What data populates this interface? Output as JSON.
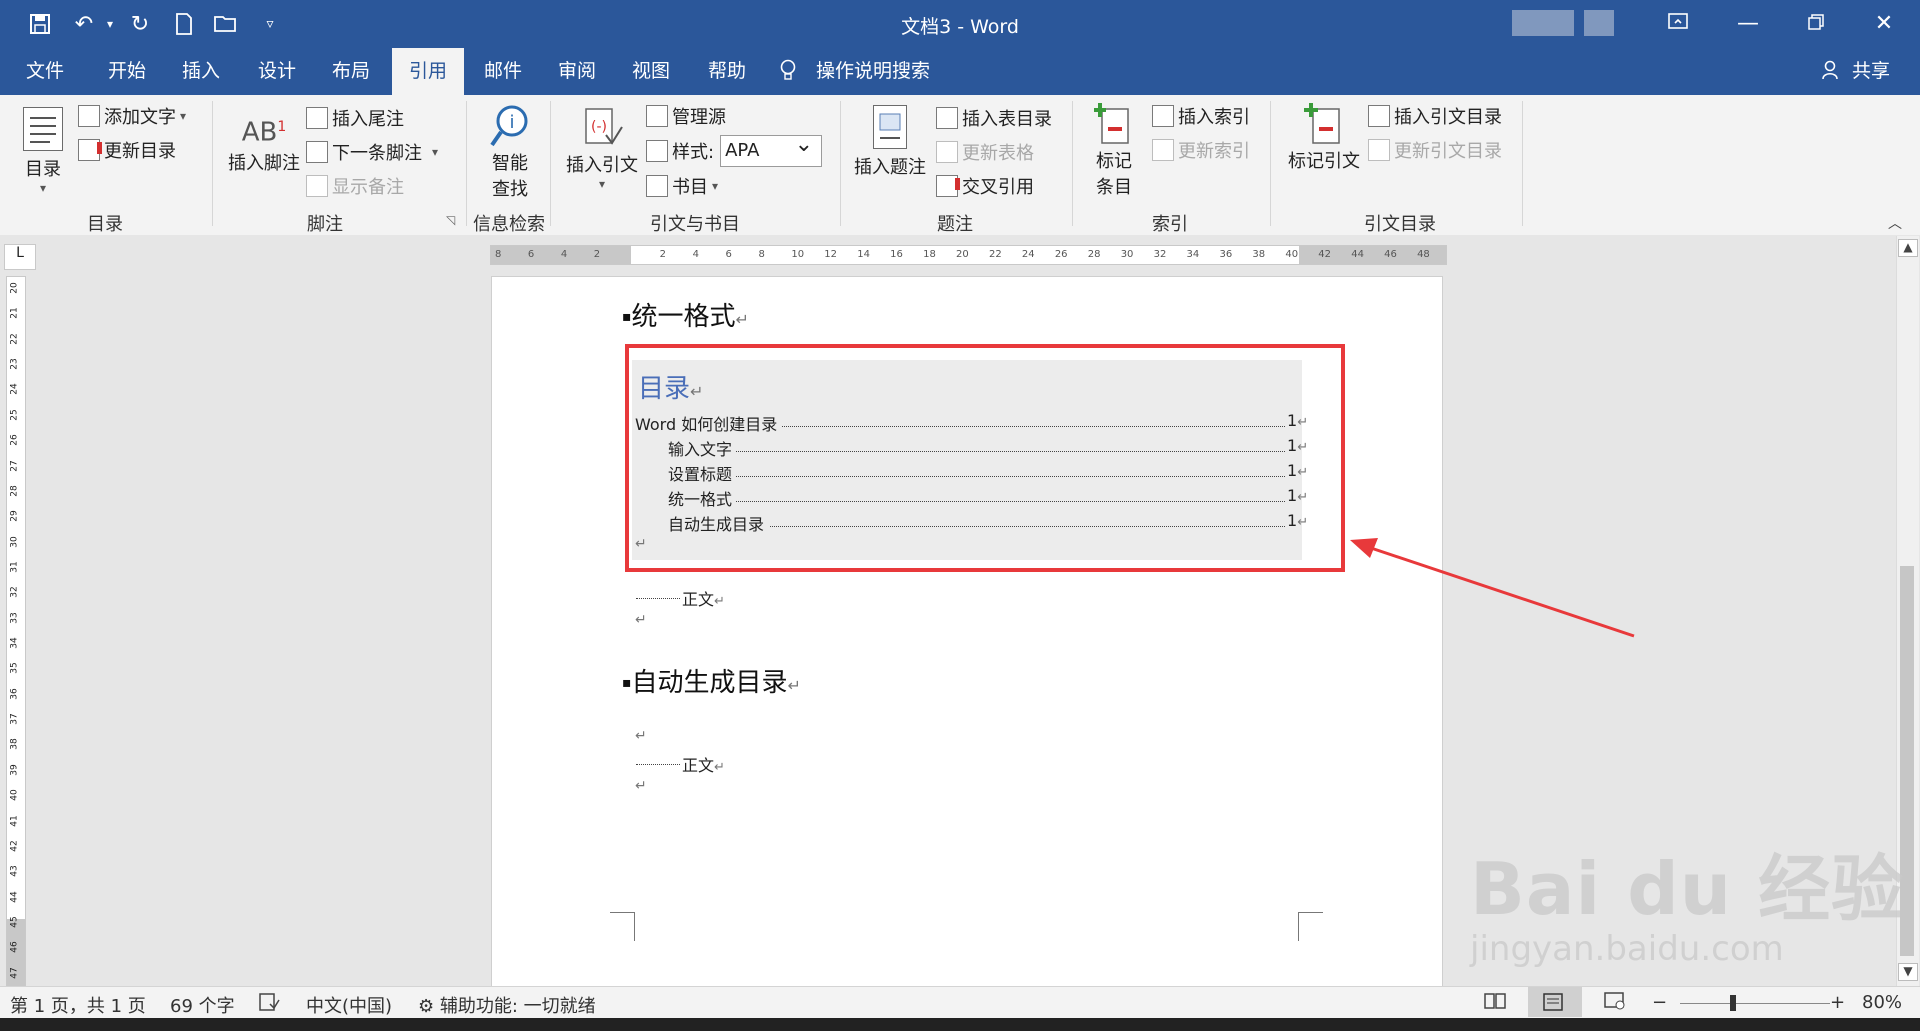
{
  "titlebar": {
    "title": "文档3  -  Word",
    "ribbon_options_icon": "ribbon-display-options-icon",
    "minimize_icon": "minimize-icon",
    "restore_icon": "restore-icon",
    "close_icon": "close-icon"
  },
  "quick_access": {
    "save_icon": "save-icon",
    "undo_icon": "undo-icon",
    "redo_icon": "redo-icon",
    "new_icon": "new-document-icon",
    "open_icon": "open-folder-icon",
    "customize_icon": "customize-dropdown-icon"
  },
  "tabs": [
    {
      "label": "文件"
    },
    {
      "label": "开始"
    },
    {
      "label": "插入"
    },
    {
      "label": "设计"
    },
    {
      "label": "布局"
    },
    {
      "label": "引用",
      "active": true
    },
    {
      "label": "邮件"
    },
    {
      "label": "审阅"
    },
    {
      "label": "视图"
    },
    {
      "label": "帮助"
    }
  ],
  "tell_me": "操作说明搜索",
  "share": "共享",
  "ribbon": {
    "toc": {
      "big_label": "目录",
      "add_text": "添加文字",
      "update_toc": "更新目录",
      "group": "目录"
    },
    "footnotes": {
      "insert_footnote": "插入脚注",
      "insert_endnote": "插入尾注",
      "next_footnote": "下一条脚注",
      "show_notes": "显示备注",
      "group": "脚注"
    },
    "research": {
      "smart_lookup_line1": "智能",
      "smart_lookup_line2": "查找",
      "group": "信息检索"
    },
    "citations": {
      "insert_citation": "插入引文",
      "manage_sources": "管理源",
      "style_label": "样式:",
      "style_value": "APA",
      "bibliography": "书目",
      "group": "引文与书目"
    },
    "captions": {
      "insert_caption": "插入题注",
      "insert_table_of_figures": "插入表目录",
      "update_table": "更新表格",
      "cross_reference": "交叉引用",
      "group": "题注"
    },
    "index": {
      "mark_entry_line1": "标记",
      "mark_entry_line2": "条目",
      "insert_index": "插入索引",
      "update_index": "更新索引",
      "group": "索引"
    },
    "authorities": {
      "mark_citation": "标记引文",
      "insert_toa": "插入引文目录",
      "update_toa": "更新引文目录",
      "group": "引文目录"
    }
  },
  "ruler": {
    "horizontal_ticks": [
      "8",
      "6",
      "4",
      "2",
      "",
      "2",
      "4",
      "6",
      "8",
      "10",
      "12",
      "14",
      "16",
      "18",
      "20",
      "22",
      "24",
      "26",
      "28",
      "30",
      "32",
      "34",
      "36",
      "38",
      "40",
      "42",
      "44",
      "46",
      "48"
    ],
    "vertical_ticks": [
      "20",
      "21",
      "22",
      "23",
      "24",
      "25",
      "26",
      "27",
      "28",
      "29",
      "30",
      "31",
      "32",
      "33",
      "34",
      "35",
      "36",
      "37",
      "38",
      "39",
      "40",
      "41",
      "42",
      "43",
      "44",
      "45",
      "46",
      "47"
    ]
  },
  "document": {
    "heading1": "统一格式",
    "toc_title": "目录",
    "toc_entries": [
      {
        "text": "Word 如何创建目录",
        "page": "1",
        "level": 1
      },
      {
        "text": "输入文字",
        "page": "1",
        "level": 2
      },
      {
        "text": "设置标题",
        "page": "1",
        "level": 2
      },
      {
        "text": "统一格式",
        "page": "1",
        "level": 2
      },
      {
        "text": "自动生成目录",
        "page": "1",
        "level": 2
      }
    ],
    "body1": "正文",
    "heading2": "自动生成目录",
    "body2": "正文",
    "para_mark": "↵",
    "bullet": "▪"
  },
  "statusbar": {
    "page": "第 1 页，共 1 页",
    "words": "69 个字",
    "language": "中文(中国)",
    "accessibility": "辅助功能: 一切就绪",
    "zoom": "80%"
  },
  "watermark": {
    "brand": "Bai du 经验",
    "url": "jingyan.baidu.com"
  },
  "colors": {
    "title_bar": "#2b579a",
    "highlight_border": "#e8393b",
    "toc_title": "#4a6eb8"
  }
}
